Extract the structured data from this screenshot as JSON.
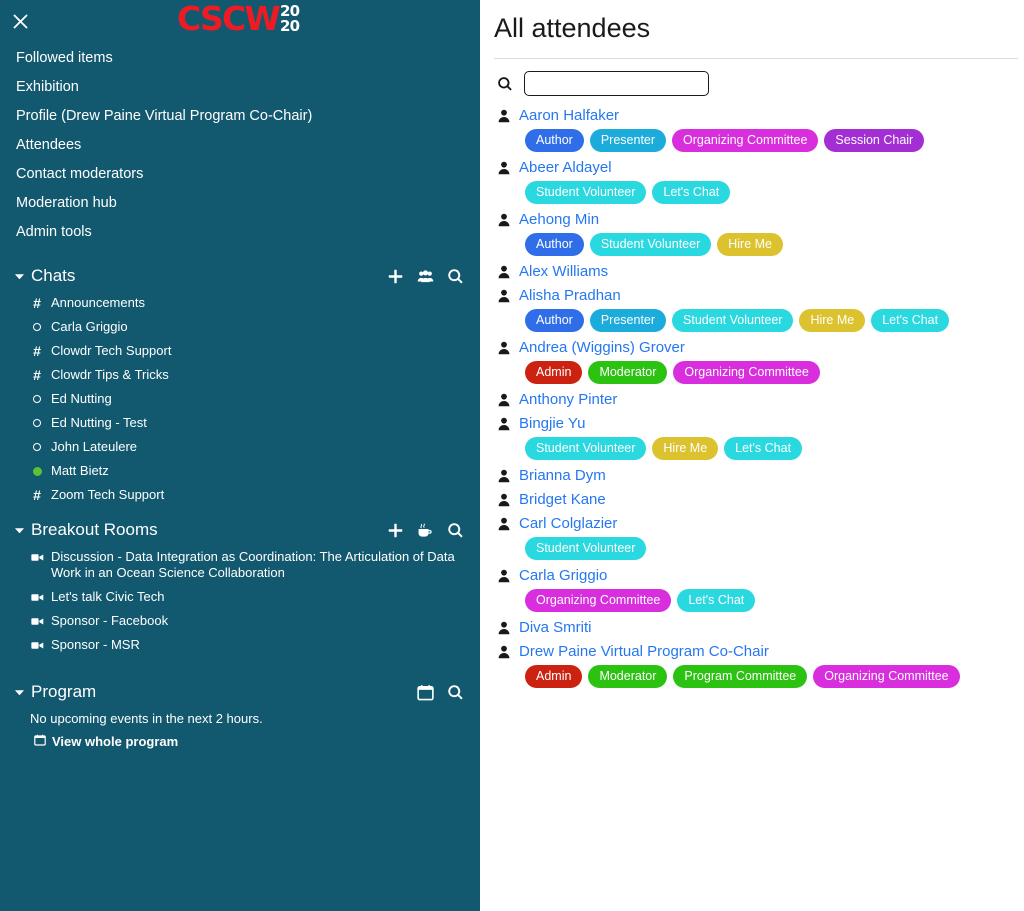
{
  "sidebar": {
    "close_icon": "close-icon",
    "logo": {
      "main": "CSCW",
      "year_top": "20",
      "year_bottom": "20",
      "color": "#ed1c24"
    },
    "nav_items": [
      {
        "label": "Followed items",
        "name": "sidebar-item-followed-items"
      },
      {
        "label": "Exhibition",
        "name": "sidebar-item-exhibition"
      },
      {
        "label": "Profile (Drew Paine Virtual Program Co-Chair)",
        "name": "sidebar-item-profile"
      },
      {
        "label": "Attendees",
        "name": "sidebar-item-attendees"
      },
      {
        "label": "Contact moderators",
        "name": "sidebar-item-contact-moderators"
      },
      {
        "label": "Moderation hub",
        "name": "sidebar-item-moderation-hub"
      },
      {
        "label": "Admin tools",
        "name": "sidebar-item-admin-tools"
      }
    ],
    "chats": {
      "title": "Chats",
      "icons": [
        "plus-icon",
        "people-group-icon",
        "search-icon"
      ],
      "items": [
        {
          "label": "Announcements",
          "type": "hash"
        },
        {
          "label": "Carla Griggio",
          "type": "circle"
        },
        {
          "label": "Clowdr Tech Support",
          "type": "hash"
        },
        {
          "label": "Clowdr Tips & Tricks",
          "type": "hash"
        },
        {
          "label": "Ed Nutting",
          "type": "circle"
        },
        {
          "label": "Ed Nutting - Test",
          "type": "circle"
        },
        {
          "label": "John Lateulere",
          "type": "circle"
        },
        {
          "label": "Matt Bietz",
          "type": "online"
        },
        {
          "label": "Zoom Tech Support",
          "type": "hash"
        }
      ]
    },
    "breakout": {
      "title": "Breakout Rooms",
      "icons": [
        "plus-icon",
        "coffee-cup-icon",
        "search-icon"
      ],
      "items": [
        {
          "label": "Discussion - Data Integration as Coordination: The Articulation of Data Work in an Ocean Science Collaboration",
          "type": "video"
        },
        {
          "label": "Let's talk Civic Tech",
          "type": "video"
        },
        {
          "label": "Sponsor - Facebook",
          "type": "video"
        },
        {
          "label": "Sponsor - MSR",
          "type": "video"
        }
      ]
    },
    "program": {
      "title": "Program",
      "icons": [
        "calendar-icon",
        "search-icon"
      ],
      "note": "No upcoming events in the next 2 hours.",
      "link_label": "View whole program"
    }
  },
  "main": {
    "title": "All attendees",
    "search": {
      "value": "",
      "placeholder": "",
      "icon": "search-icon"
    },
    "badge_colors": {
      "Author": "#2f6ee8",
      "Presenter": "#1cacdb",
      "Organizing Committee": "#d82ede",
      "Session Chair": "#a32ed4",
      "Student Volunteer": "#2ad8e0",
      "Let's Chat": "#2ad8e0",
      "Hire Me": "#dbc22e",
      "Admin": "#cc2211",
      "Moderator": "#2cc211",
      "Program Committee": "#2cc211"
    },
    "attendees": [
      {
        "name": "Aaron Halfaker",
        "badges": [
          "Author",
          "Presenter",
          "Organizing Committee",
          "Session Chair"
        ]
      },
      {
        "name": "Abeer Aldayel",
        "badges": [
          "Student Volunteer",
          "Let's Chat"
        ]
      },
      {
        "name": "Aehong Min",
        "badges": [
          "Author",
          "Student Volunteer",
          "Hire Me"
        ]
      },
      {
        "name": "Alex Williams",
        "badges": []
      },
      {
        "name": "Alisha Pradhan",
        "badges": [
          "Author",
          "Presenter",
          "Student Volunteer",
          "Hire Me",
          "Let's Chat"
        ]
      },
      {
        "name": "Andrea (Wiggins) Grover",
        "badges": [
          "Admin",
          "Moderator",
          "Organizing Committee"
        ]
      },
      {
        "name": "Anthony Pinter",
        "badges": []
      },
      {
        "name": "Bingjie Yu",
        "badges": [
          "Student Volunteer",
          "Hire Me",
          "Let's Chat"
        ]
      },
      {
        "name": "Brianna Dym",
        "badges": []
      },
      {
        "name": "Bridget Kane",
        "badges": []
      },
      {
        "name": "Carl Colglazier",
        "badges": [
          "Student Volunteer"
        ]
      },
      {
        "name": "Carla Griggio",
        "badges": [
          "Organizing Committee",
          "Let's Chat"
        ]
      },
      {
        "name": "Diva Smriti",
        "badges": []
      },
      {
        "name": "Drew Paine Virtual Program Co-Chair",
        "badges": [
          "Admin",
          "Moderator",
          "Program Committee",
          "Organizing Committee"
        ]
      }
    ]
  }
}
